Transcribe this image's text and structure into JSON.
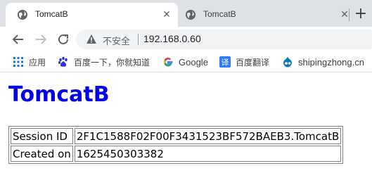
{
  "tabs": [
    {
      "title": "TomcatB",
      "active": true
    },
    {
      "title": "TomcatB",
      "active": false
    }
  ],
  "toolbar": {
    "security_label": "不安全",
    "url": "192.168.0.60"
  },
  "bookmarks": [
    {
      "label": "应用",
      "icon": "apps-grid-icon"
    },
    {
      "label": "百度一下，你就知道",
      "icon": "baidu-paw-icon"
    },
    {
      "label": "Google",
      "icon": "google-g-icon"
    },
    {
      "label": "百度翻译",
      "icon": "baidu-translate-icon"
    },
    {
      "label": "shipingzhong.cn",
      "icon": "drupal-drop-icon"
    }
  ],
  "page": {
    "title": "TomcatB",
    "title_color": "#0000ee",
    "rows": [
      {
        "label": "Session ID",
        "value": "2F1C1588F02F00F3431523BF572BAEB3.TomcatB"
      },
      {
        "label": "Created on",
        "value": "1625450303382"
      }
    ]
  }
}
